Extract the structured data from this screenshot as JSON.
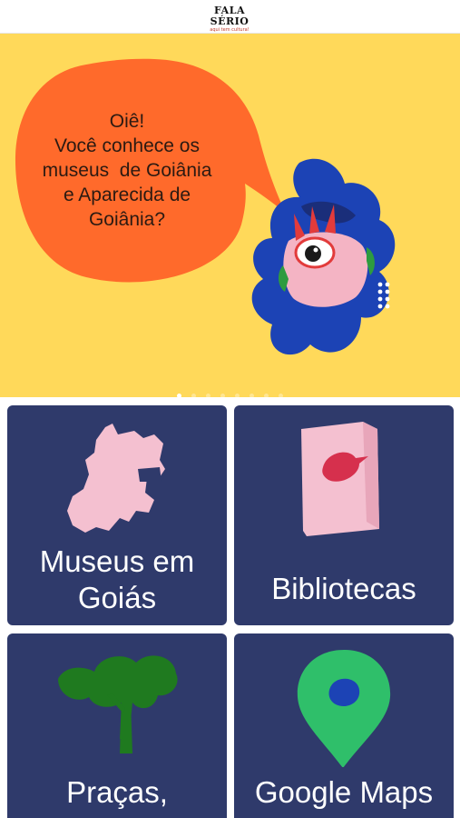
{
  "header": {
    "logo_text": "FALA SÉRIO",
    "logo_tagline": "aqui tem cultura!"
  },
  "hero": {
    "speech_lines": [
      "Oiê!",
      "Você conhece os",
      "museus  de Goiânia",
      "e Aparecida de",
      "Goiânia?"
    ],
    "background_color": "#ffd95a",
    "bubble_color": "#ff6a2b",
    "character_color": "#1c43b5",
    "carousel_pages": 8,
    "carousel_active": 1
  },
  "menu": {
    "items": [
      {
        "label": "Museus em\nGoiás",
        "icon": "goias-map-icon"
      },
      {
        "label": "Bibliotecas",
        "icon": "book-icon"
      },
      {
        "label": "Praças,",
        "icon": "tree-icon"
      },
      {
        "label": "Google Maps",
        "icon": "map-pin-icon"
      }
    ],
    "card_color": "#2f3a6b"
  }
}
